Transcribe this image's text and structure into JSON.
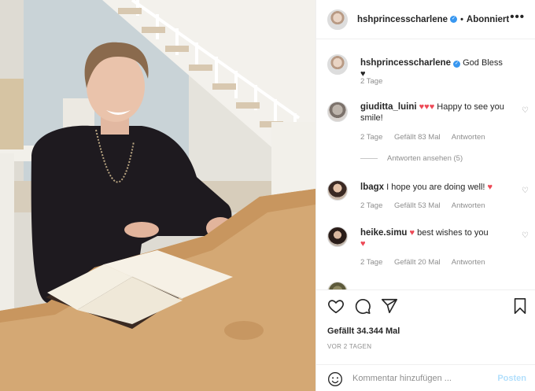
{
  "header": {
    "username": "hshprincesscharlene",
    "separator": "•",
    "follow_status": "Abonniert",
    "more": "•••"
  },
  "caption": {
    "username": "hshprincesscharlene",
    "text": "God Bless",
    "time": "2 Tage"
  },
  "comments": [
    {
      "username": "giuditta_luini",
      "text": "Happy to see you smile!",
      "time": "2 Tage",
      "likes": "Gefällt 83 Mal",
      "reply": "Antworten"
    },
    {
      "username": "lbagx",
      "text": "I hope you are doing well!",
      "time": "2 Tage",
      "likes": "Gefällt 53 Mal",
      "reply": "Antworten"
    },
    {
      "username": "heike.simu",
      "text": "best wishes to you",
      "time": "2 Tage",
      "likes": "Gefällt 20 Mal",
      "reply": "Antworten"
    }
  ],
  "view_replies": "Antworten ansehen (5)",
  "post_stats": {
    "likes": "Gefällt 34.344 Mal",
    "date": "VOR 2 TAGEN"
  },
  "composer": {
    "placeholder": "Kommentar hinzufügen ...",
    "post_label": "Posten"
  },
  "colors": {
    "verified": "#3897f0",
    "heart": "#ed4956",
    "post_disabled": "#b2dffc",
    "secondary_text": "#8e8e8e"
  }
}
